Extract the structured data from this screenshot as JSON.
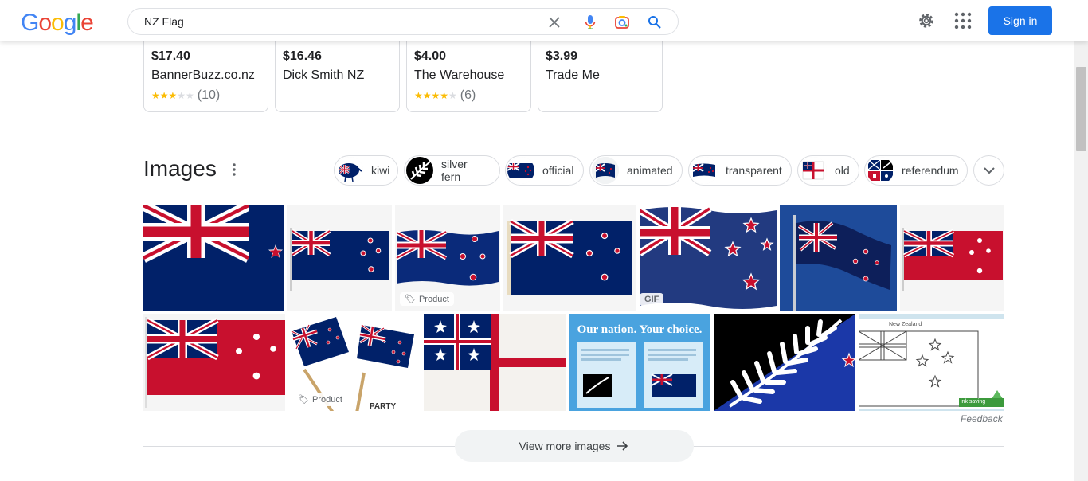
{
  "header": {
    "logo": [
      "G",
      "o",
      "o",
      "g",
      "l",
      "e"
    ],
    "logo_colors": [
      "#4285f4",
      "#ea4335",
      "#fbbc05",
      "#4285f4",
      "#34a853",
      "#ea4335"
    ],
    "search_value": "NZ Flag",
    "signin_label": "Sign in"
  },
  "products": [
    {
      "price": "$17.40",
      "store": "BannerBuzz.co.nz",
      "stars": 3,
      "reviews": "(10)"
    },
    {
      "price": "$16.46",
      "store": "Dick Smith NZ",
      "stars": null,
      "reviews": ""
    },
    {
      "price": "$4.00",
      "store": "The Warehouse",
      "stars": 4,
      "reviews": "(6)"
    },
    {
      "price": "$3.99",
      "store": "Trade Me",
      "stars": null,
      "reviews": ""
    }
  ],
  "images": {
    "title": "Images",
    "chips": [
      "kiwi",
      "silver fern",
      "official",
      "animated",
      "transparent",
      "old",
      "referendum"
    ],
    "product_badge": "Product",
    "gif_badge": "GIF",
    "tile3_text": "Our nation. Your choice.",
    "tile5_watermark": "PARTY",
    "tile6_caption": "New Zealand",
    "tile6_badge": "ink saving",
    "feedback": "Feedback",
    "view_more": "View more images"
  },
  "colors": {
    "nz_blue": "#012169",
    "nz_red": "#c8102e",
    "google_blue": "#1a73e8"
  }
}
